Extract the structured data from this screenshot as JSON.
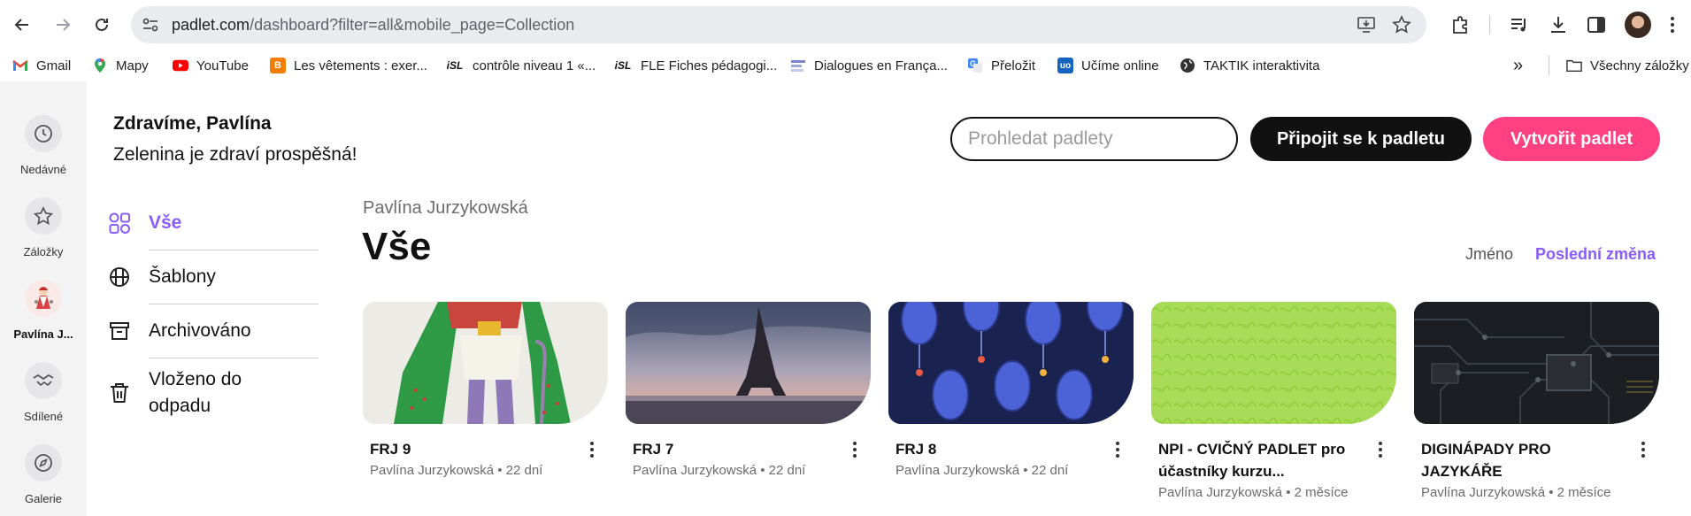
{
  "browser": {
    "url_host": "padlet.com",
    "url_path": "/dashboard?filter=all&mobile_page=Collection",
    "bookmarks": [
      {
        "label": "Gmail",
        "icon": "gmail-icon"
      },
      {
        "label": "Mapy",
        "icon": "maps-icon"
      },
      {
        "label": "YouTube",
        "icon": "youtube-icon"
      },
      {
        "label": "Les vêtements : exer...",
        "icon": "blogger-icon"
      },
      {
        "label": "contrôle niveau 1 «...",
        "icon": "isl-icon"
      },
      {
        "label": "FLE Fiches pédagogi...",
        "icon": "isl-icon"
      },
      {
        "label": "Dialogues en França...",
        "icon": "dialogues-icon"
      },
      {
        "label": "Přeložit",
        "icon": "translate-icon"
      },
      {
        "label": "Učíme online",
        "icon": "ucime-online-icon"
      },
      {
        "label": "TAKTIK interaktivita",
        "icon": "globe-icon"
      }
    ],
    "bookmarks_overflow": "»",
    "all_bookmarks": "Všechny záložky",
    "isl_mark": "iSL",
    "colors": {
      "youtube": "#ff0000",
      "blogger": "#f57d00",
      "ucime": "#1565c0"
    }
  },
  "rail": {
    "items": [
      {
        "label": "Nedávné",
        "icon": "clock-icon"
      },
      {
        "label": "Záložky",
        "icon": "star-icon"
      },
      {
        "label": "Pavlína J...",
        "icon": "avatar"
      },
      {
        "label": "Sdílené",
        "icon": "handshake-icon"
      },
      {
        "label": "Galerie",
        "icon": "compass-icon"
      }
    ]
  },
  "header": {
    "greeting": "Zdravíme, Pavlína",
    "message": "Zelenina je zdraví prospěšná!",
    "search_placeholder": "Prohledat padlety",
    "join_label": "Připojit se k padletu",
    "create_label": "Vytvořit padlet",
    "colors": {
      "create": "#ff4081",
      "join": "#111111"
    }
  },
  "filters": [
    {
      "label": "Vše",
      "icon": "grid-shapes-icon",
      "active": true
    },
    {
      "label": "Šablony",
      "icon": "template-icon",
      "active": false
    },
    {
      "label": "Archivováno",
      "icon": "archive-icon",
      "active": false
    },
    {
      "label": "Vloženo do odpadu",
      "icon": "trash-icon",
      "active": false
    }
  ],
  "main": {
    "owner": "Pavlína Jurzykowská",
    "title": "Vše",
    "sort_name": "Jméno",
    "sort_recent": "Poslední změna",
    "accent": "#8a5cf6"
  },
  "cards": [
    {
      "title": "FRJ 9",
      "author": "Pavlína Jurzykowská",
      "age": "22 dní",
      "meta": "Pavlína Jurzykowská • 22 dní",
      "image": "little-prince-illustration"
    },
    {
      "title": "FRJ 7",
      "author": "Pavlína Jurzykowská",
      "age": "22 dní",
      "meta": "Pavlína Jurzykowská • 22 dní",
      "image": "eiffel-tower-photo"
    },
    {
      "title": "FRJ 8",
      "author": "Pavlína Jurzykowská",
      "age": "22 dní",
      "meta": "Pavlína Jurzykowská • 22 dní",
      "image": "blue-lanterns-pattern"
    },
    {
      "title": "NPI - CVIČNÝ PADLET pro účastníky kurzu...",
      "author": "Pavlína Jurzykowská",
      "age": "2 měsíce",
      "meta": "Pavlína Jurzykowská • 2 měsíce",
      "image": "green-squiggle-pattern"
    },
    {
      "title": "DIGINÁPADY PRO JAZYKÁŘE",
      "author": "Pavlína Jurzykowská",
      "age": "2 měsíce",
      "meta": "Pavlína Jurzykowská • 2 měsíce",
      "image": "circuit-board-photo"
    }
  ]
}
